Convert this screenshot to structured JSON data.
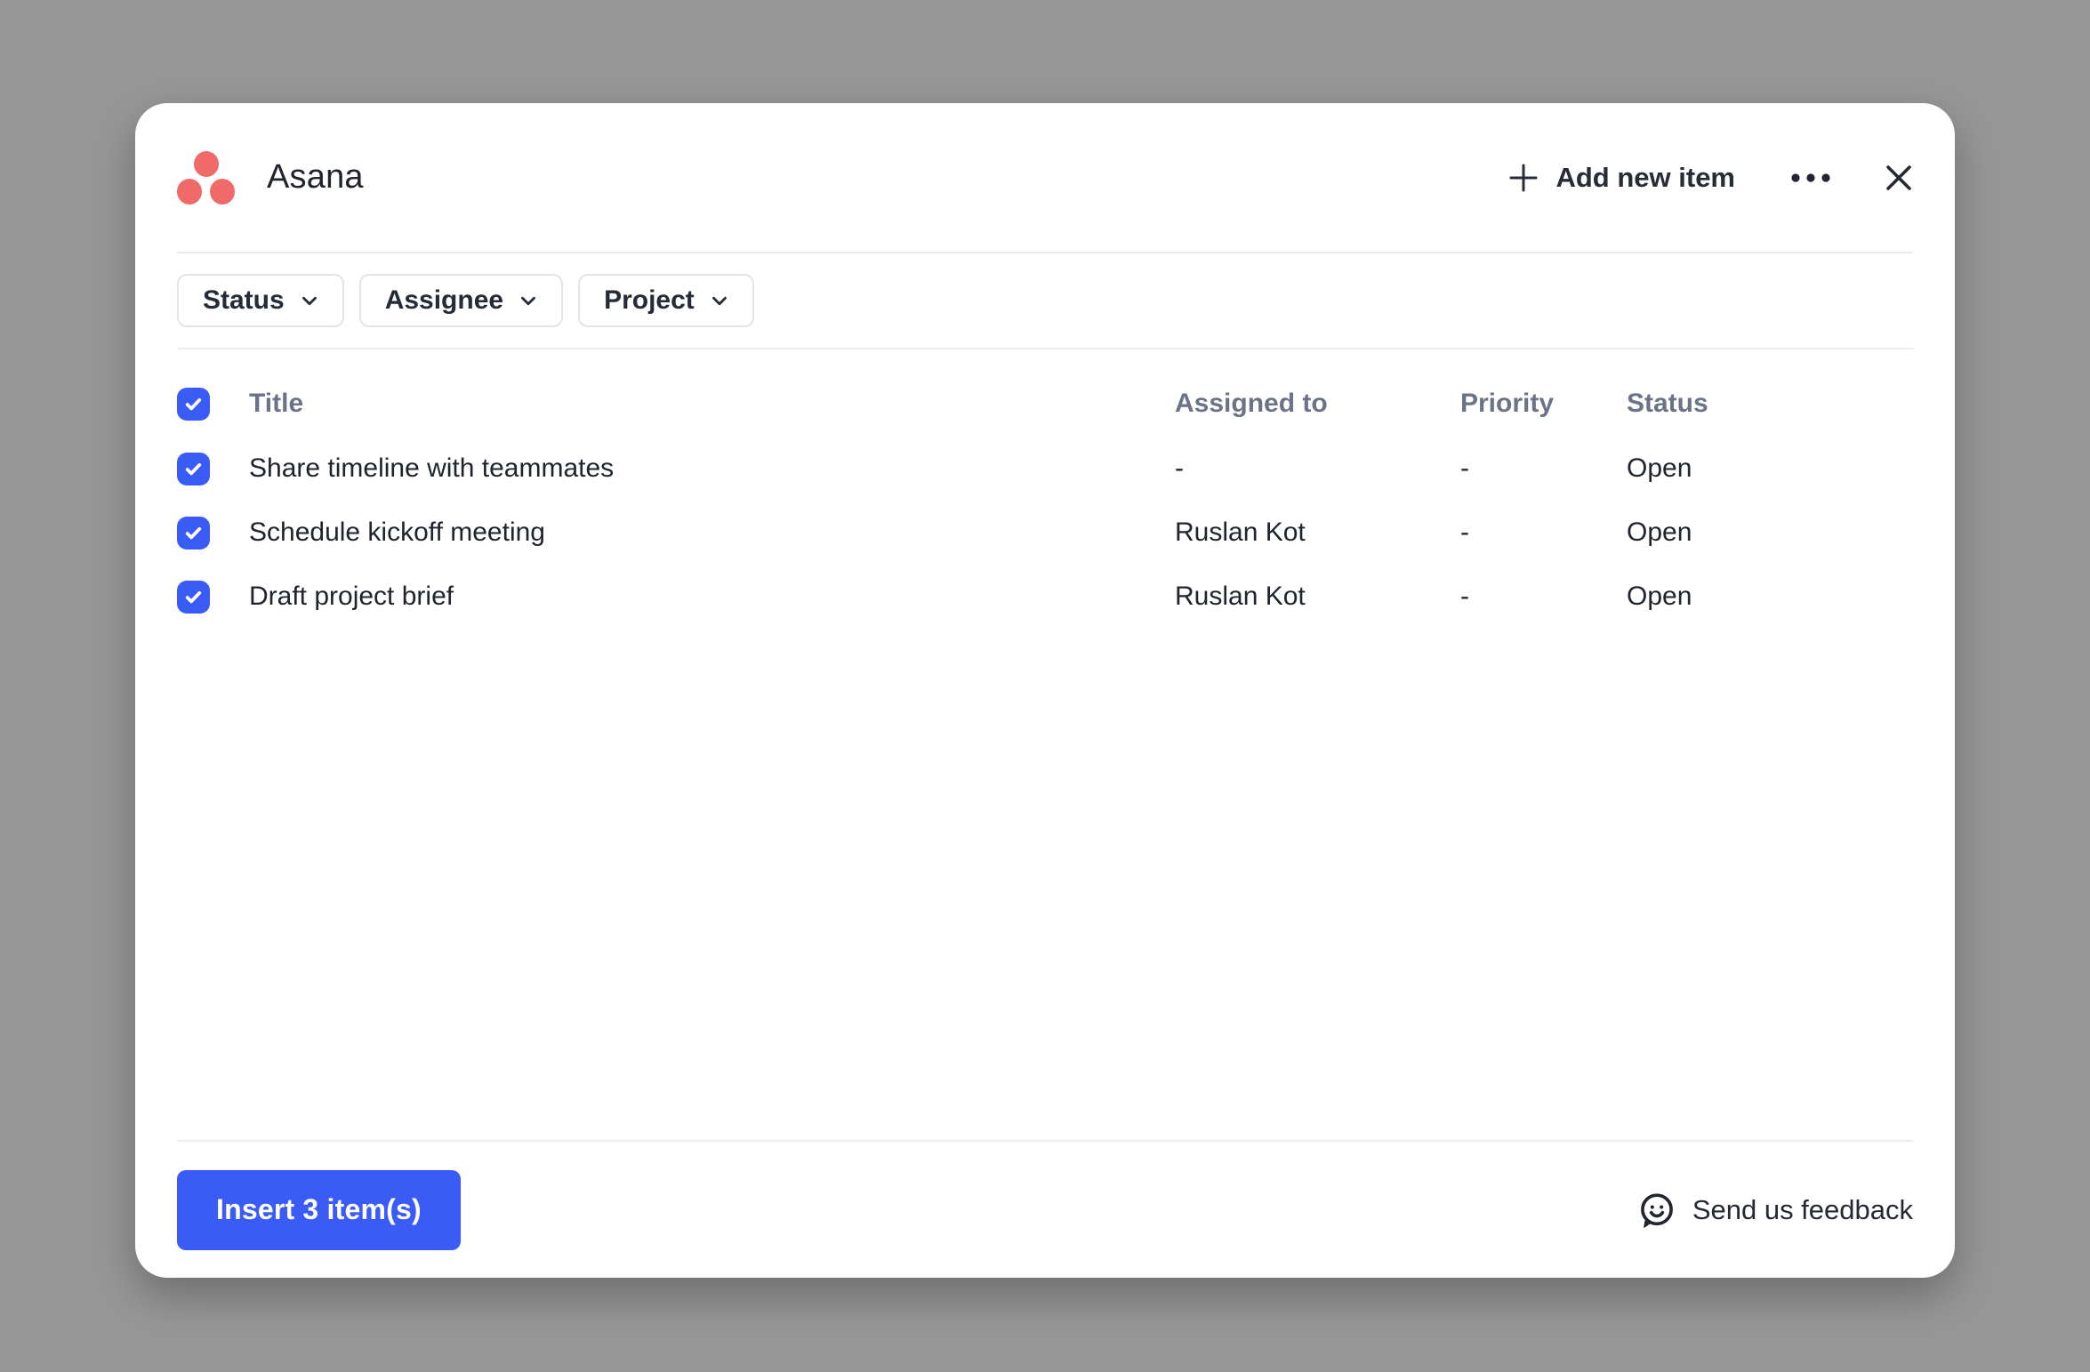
{
  "window": {
    "app_title": "Asana"
  },
  "header": {
    "add_new_item_label": "Add new item"
  },
  "filters": [
    {
      "label": "Status"
    },
    {
      "label": "Assignee"
    },
    {
      "label": "Project"
    }
  ],
  "table": {
    "columns": [
      "Title",
      "Assigned to",
      "Priority",
      "Status"
    ],
    "select_all_checked": true,
    "rows": [
      {
        "checked": true,
        "title": "Share timeline with teammates",
        "assigned_to": "-",
        "priority": "-",
        "status": "Open"
      },
      {
        "checked": true,
        "title": "Schedule kickoff meeting",
        "assigned_to": "Ruslan Kot",
        "priority": "-",
        "status": "Open"
      },
      {
        "checked": true,
        "title": "Draft project brief",
        "assigned_to": "Ruslan Kot",
        "priority": "-",
        "status": "Open"
      }
    ]
  },
  "footer": {
    "insert_label": "Insert 3 item(s)",
    "feedback_label": "Send us feedback"
  },
  "colors": {
    "accent_blue": "#3b5bf6",
    "logo_coral": "#f06a6a",
    "column_header_text": "#6b7486",
    "body_text": "#20242e",
    "backdrop": "#979797"
  },
  "icons": {
    "logo": "asana-three-dots",
    "add": "plus-icon",
    "more": "ellipsis-icon",
    "close": "x-icon",
    "filter_chevron": "chevron-down-icon",
    "checkbox": "checkmark-icon",
    "feedback": "smiley-speech-bubble-icon"
  }
}
